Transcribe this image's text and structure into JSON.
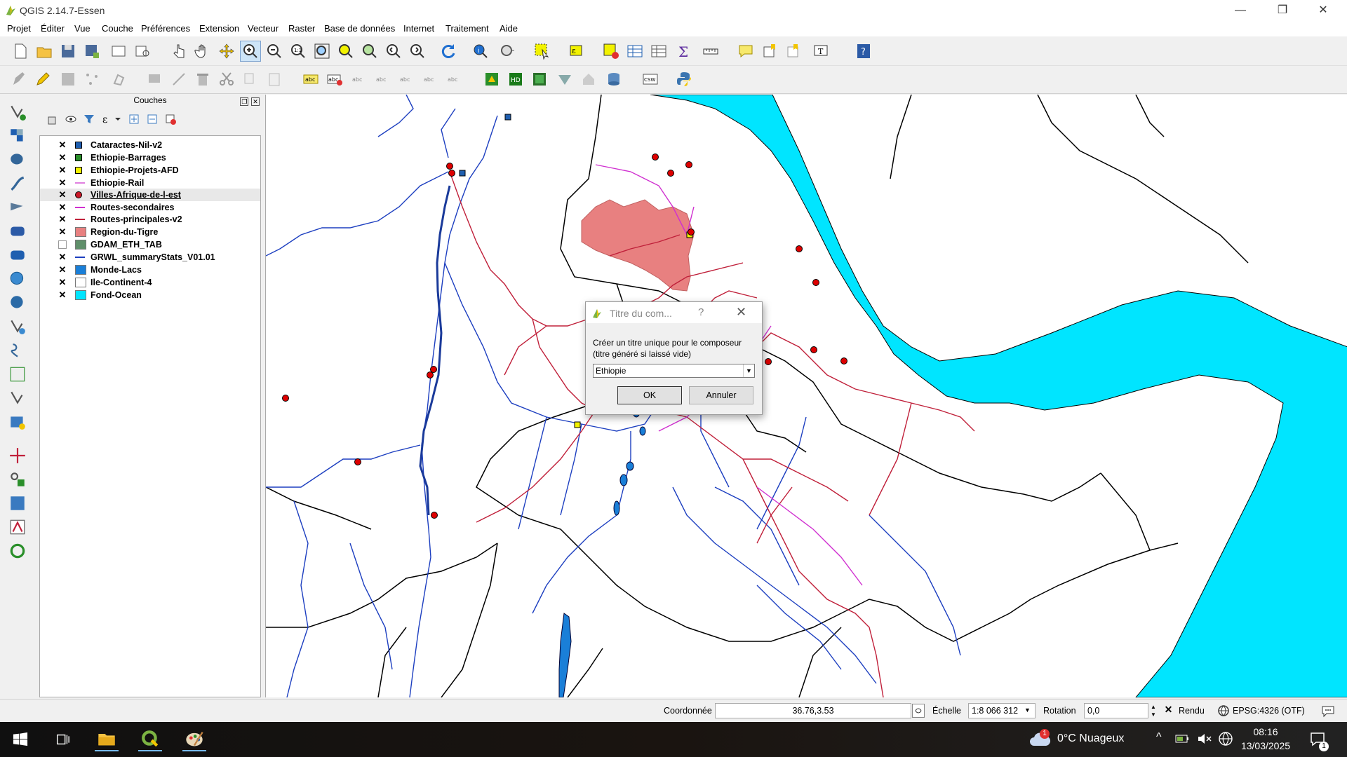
{
  "window": {
    "title": "QGIS 2.14.7-Essen",
    "minimize": "—",
    "restore": "❐",
    "close": "✕"
  },
  "menubar": [
    "Projet",
    "Éditer",
    "Vue",
    "Couche",
    "Préférences",
    "Extension",
    "Vecteur",
    "Raster",
    "Base de données",
    "Internet",
    "Traitement",
    "Aide"
  ],
  "layers_panel": {
    "title": "Couches",
    "layers": [
      {
        "name": "Cataractes-Nil-v2",
        "checked": true,
        "symbol": "square",
        "color": "#1f5fb0"
      },
      {
        "name": "Ethiopie-Barrages",
        "checked": true,
        "symbol": "square",
        "color": "#2a8f2a"
      },
      {
        "name": "Ethiopie-Projets-AFD",
        "checked": true,
        "symbol": "square",
        "color": "#f2f200"
      },
      {
        "name": "Ethiopie-Rail",
        "checked": true,
        "symbol": "line",
        "color": "#e080e0"
      },
      {
        "name": "Villes-Afrique-de-l-est",
        "checked": true,
        "symbol": "circle",
        "color": "#cc1a2a"
      },
      {
        "name": "Routes-secondaires",
        "checked": true,
        "symbol": "line",
        "color": "#d030d0"
      },
      {
        "name": "Routes-principales-v2",
        "checked": true,
        "symbol": "line",
        "color": "#c0203a"
      },
      {
        "name": "Region-du-Tigre",
        "checked": true,
        "symbol": "fill",
        "color": "#e88080"
      },
      {
        "name": "GDAM_ETH_TAB",
        "checked": false,
        "symbol": "fill",
        "color": "#5f8f6a"
      },
      {
        "name": "GRWL_summaryStats_V01.01",
        "checked": true,
        "symbol": "line",
        "color": "#1d3fc0"
      },
      {
        "name": "Monde-Lacs",
        "checked": true,
        "symbol": "fill",
        "color": "#1a7fd8"
      },
      {
        "name": "Ile-Continent-4",
        "checked": true,
        "symbol": "fill",
        "color": "#ffffff"
      },
      {
        "name": "Fond-Ocean",
        "checked": true,
        "symbol": "fill",
        "color": "#00e5ff"
      }
    ]
  },
  "dialog": {
    "title": "Titre du com...",
    "help": "?",
    "close": "✕",
    "message": "Créer un titre unique pour le composeur (titre généré si laissé vide)",
    "combo_value": "Ethiopie",
    "ok": "OK",
    "cancel": "Annuler"
  },
  "statusbar": {
    "coord_label": "Coordonnée",
    "coord_value": "36.76,3.53",
    "scale_label": "Échelle",
    "scale_value": "1:8 066 312",
    "rotation_label": "Rotation",
    "rotation_value": "0,0",
    "render_label": "Rendu",
    "crs": "EPSG:4326 (OTF)"
  },
  "taskbar": {
    "weather": "0°C  Nuageux",
    "time": "08:16",
    "date": "13/03/2025",
    "notification_count": "1",
    "weather_badge": "1"
  },
  "colors": {
    "ocean": "#00e5ff",
    "tigray": "#e88080",
    "rivers": "#1d3fc0",
    "roads": "#c0203a",
    "cities": "#dd0000",
    "afd": "#f2f200"
  }
}
